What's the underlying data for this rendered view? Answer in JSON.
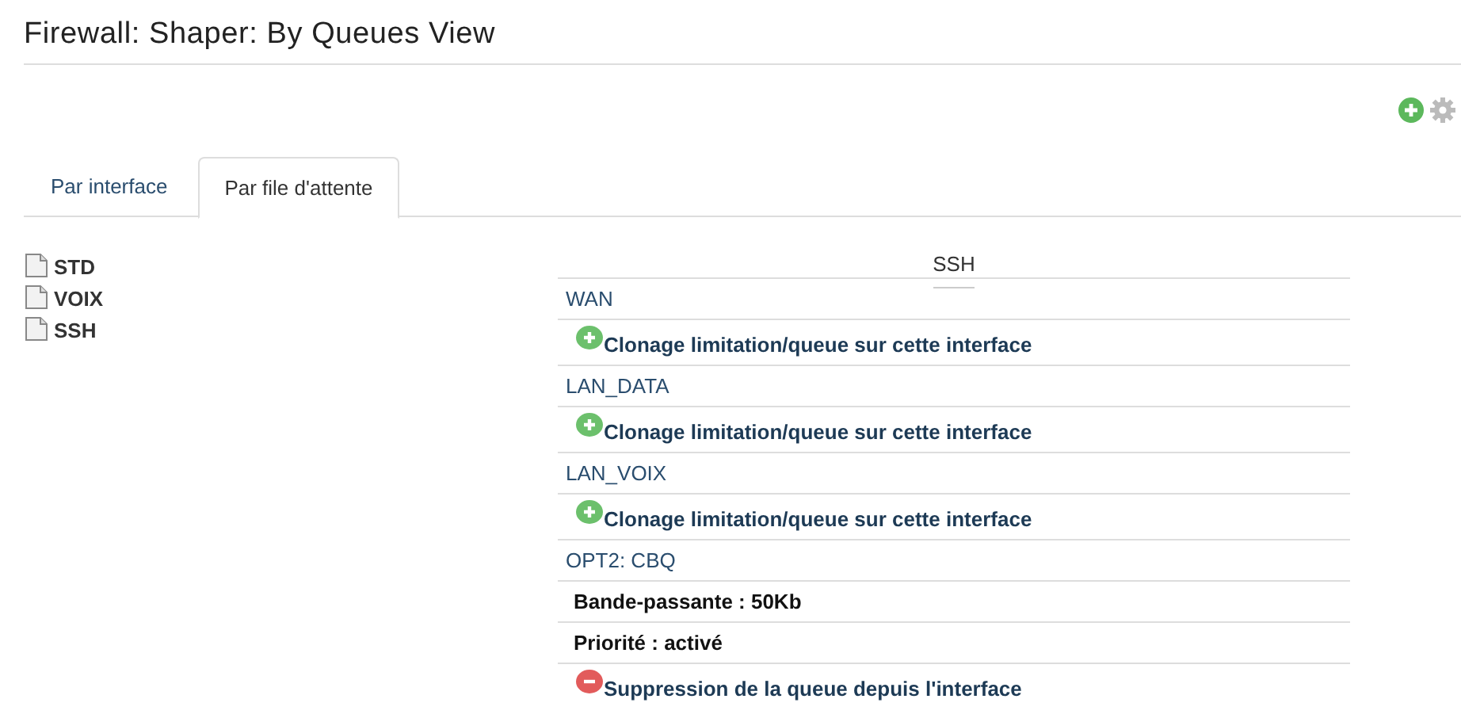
{
  "title": "Firewall: Shaper: By Queues View",
  "tabs": [
    {
      "label": "Par interface",
      "selected": false
    },
    {
      "label": "Par file d'attente",
      "selected": true
    }
  ],
  "tree": [
    {
      "label": "STD"
    },
    {
      "label": "VOIX"
    },
    {
      "label": "SSH"
    }
  ],
  "queue": {
    "heading": "SSH",
    "rows": [
      {
        "kind": "interface",
        "text": "WAN"
      },
      {
        "kind": "clone",
        "text": "Clonage limitation/queue sur cette interface"
      },
      {
        "kind": "interface",
        "text": "LAN_DATA"
      },
      {
        "kind": "clone",
        "text": "Clonage limitation/queue sur cette interface"
      },
      {
        "kind": "interface",
        "text": "LAN_VOIX"
      },
      {
        "kind": "clone",
        "text": "Clonage limitation/queue sur cette interface"
      },
      {
        "kind": "interface",
        "text": "OPT2: CBQ"
      },
      {
        "kind": "info",
        "text": "Bande-passante : 50Kb"
      },
      {
        "kind": "info",
        "text": "Priorité : activé"
      },
      {
        "kind": "delete",
        "text": "Suppression de la queue depuis l'interface"
      }
    ]
  }
}
